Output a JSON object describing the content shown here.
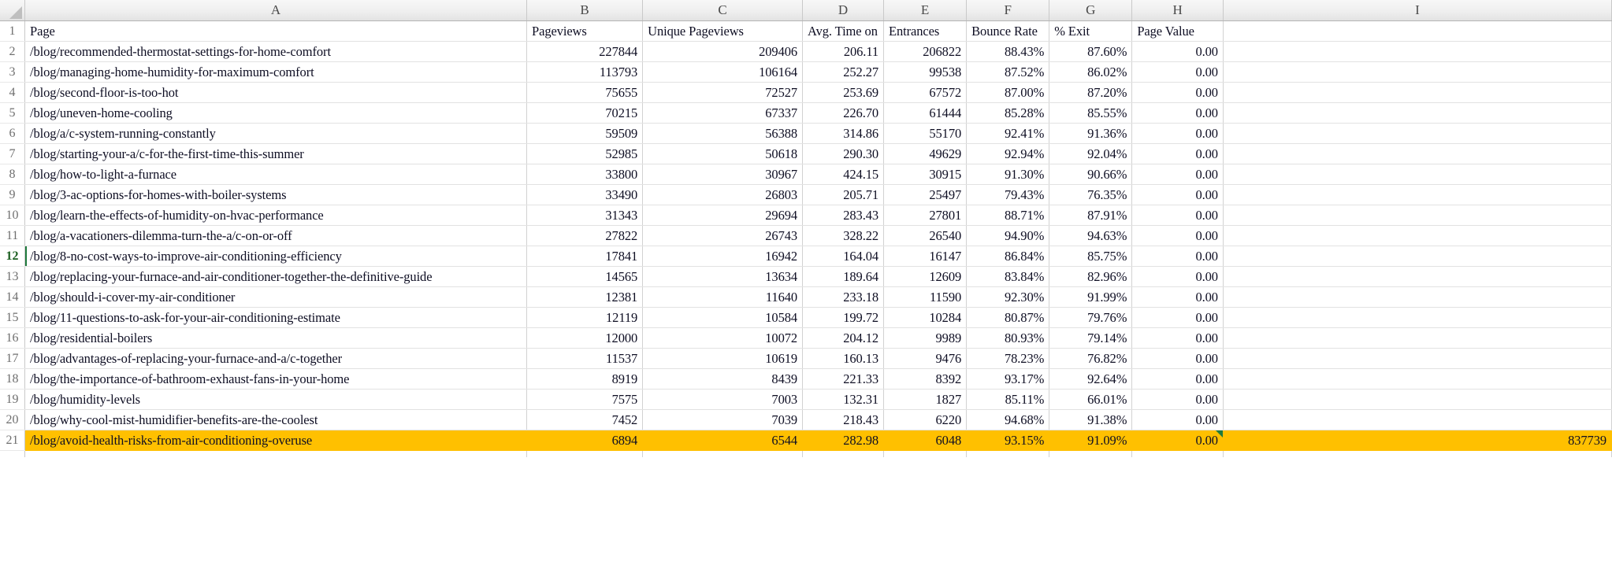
{
  "app": {
    "type": "spreadsheet",
    "highlight_color": "#ffc000",
    "active_color": "#1f7a3d"
  },
  "column_letters": [
    "A",
    "B",
    "C",
    "D",
    "E",
    "F",
    "G",
    "H",
    "I"
  ],
  "headers": [
    "Page",
    "Pageviews",
    "Unique Pageviews",
    "Avg. Time on",
    "Entrances",
    "Bounce Rate",
    "% Exit",
    "Page Value",
    ""
  ],
  "rows": [
    {
      "n": "2",
      "page": "/blog/recommended-thermostat-settings-for-home-comfort",
      "pageviews": "227844",
      "unique": "209406",
      "time": "206.11",
      "entrances": "206822",
      "bounce": "88.43%",
      "exit": "87.60%",
      "value": "0.00",
      "extra": ""
    },
    {
      "n": "3",
      "page": "/blog/managing-home-humidity-for-maximum-comfort",
      "pageviews": "113793",
      "unique": "106164",
      "time": "252.27",
      "entrances": "99538",
      "bounce": "87.52%",
      "exit": "86.02%",
      "value": "0.00",
      "extra": ""
    },
    {
      "n": "4",
      "page": "/blog/second-floor-is-too-hot",
      "pageviews": "75655",
      "unique": "72527",
      "time": "253.69",
      "entrances": "67572",
      "bounce": "87.00%",
      "exit": "87.20%",
      "value": "0.00",
      "extra": ""
    },
    {
      "n": "5",
      "page": "/blog/uneven-home-cooling",
      "pageviews": "70215",
      "unique": "67337",
      "time": "226.70",
      "entrances": "61444",
      "bounce": "85.28%",
      "exit": "85.55%",
      "value": "0.00",
      "extra": ""
    },
    {
      "n": "6",
      "page": "/blog/a/c-system-running-constantly",
      "pageviews": "59509",
      "unique": "56388",
      "time": "314.86",
      "entrances": "55170",
      "bounce": "92.41%",
      "exit": "91.36%",
      "value": "0.00",
      "extra": ""
    },
    {
      "n": "7",
      "page": "/blog/starting-your-a/c-for-the-first-time-this-summer",
      "pageviews": "52985",
      "unique": "50618",
      "time": "290.30",
      "entrances": "49629",
      "bounce": "92.94%",
      "exit": "92.04%",
      "value": "0.00",
      "extra": ""
    },
    {
      "n": "8",
      "page": "/blog/how-to-light-a-furnace",
      "pageviews": "33800",
      "unique": "30967",
      "time": "424.15",
      "entrances": "30915",
      "bounce": "91.30%",
      "exit": "90.66%",
      "value": "0.00",
      "extra": ""
    },
    {
      "n": "9",
      "page": "/blog/3-ac-options-for-homes-with-boiler-systems",
      "pageviews": "33490",
      "unique": "26803",
      "time": "205.71",
      "entrances": "25497",
      "bounce": "79.43%",
      "exit": "76.35%",
      "value": "0.00",
      "extra": ""
    },
    {
      "n": "10",
      "page": "/blog/learn-the-effects-of-humidity-on-hvac-performance",
      "pageviews": "31343",
      "unique": "29694",
      "time": "283.43",
      "entrances": "27801",
      "bounce": "88.71%",
      "exit": "87.91%",
      "value": "0.00",
      "extra": ""
    },
    {
      "n": "11",
      "page": "/blog/a-vacationers-dilemma-turn-the-a/c-on-or-off",
      "pageviews": "27822",
      "unique": "26743",
      "time": "328.22",
      "entrances": "26540",
      "bounce": "94.90%",
      "exit": "94.63%",
      "value": "0.00",
      "extra": ""
    },
    {
      "n": "12",
      "page": "/blog/8-no-cost-ways-to-improve-air-conditioning-efficiency",
      "pageviews": "17841",
      "unique": "16942",
      "time": "164.04",
      "entrances": "16147",
      "bounce": "86.84%",
      "exit": "85.75%",
      "value": "0.00",
      "extra": ""
    },
    {
      "n": "13",
      "page": "/blog/replacing-your-furnace-and-air-conditioner-together-the-definitive-guide",
      "pageviews": "14565",
      "unique": "13634",
      "time": "189.64",
      "entrances": "12609",
      "bounce": "83.84%",
      "exit": "82.96%",
      "value": "0.00",
      "extra": ""
    },
    {
      "n": "14",
      "page": "/blog/should-i-cover-my-air-conditioner",
      "pageviews": "12381",
      "unique": "11640",
      "time": "233.18",
      "entrances": "11590",
      "bounce": "92.30%",
      "exit": "91.99%",
      "value": "0.00",
      "extra": ""
    },
    {
      "n": "15",
      "page": "/blog/11-questions-to-ask-for-your-air-conditioning-estimate",
      "pageviews": "12119",
      "unique": "10584",
      "time": "199.72",
      "entrances": "10284",
      "bounce": "80.87%",
      "exit": "79.76%",
      "value": "0.00",
      "extra": ""
    },
    {
      "n": "16",
      "page": "/blog/residential-boilers",
      "pageviews": "12000",
      "unique": "10072",
      "time": "204.12",
      "entrances": "9989",
      "bounce": "80.93%",
      "exit": "79.14%",
      "value": "0.00",
      "extra": ""
    },
    {
      "n": "17",
      "page": "/blog/advantages-of-replacing-your-furnace-and-a/c-together",
      "pageviews": "11537",
      "unique": "10619",
      "time": "160.13",
      "entrances": "9476",
      "bounce": "78.23%",
      "exit": "76.82%",
      "value": "0.00",
      "extra": ""
    },
    {
      "n": "18",
      "page": "/blog/the-importance-of-bathroom-exhaust-fans-in-your-home",
      "pageviews": "8919",
      "unique": "8439",
      "time": "221.33",
      "entrances": "8392",
      "bounce": "93.17%",
      "exit": "92.64%",
      "value": "0.00",
      "extra": ""
    },
    {
      "n": "19",
      "page": "/blog/humidity-levels",
      "pageviews": "7575",
      "unique": "7003",
      "time": "132.31",
      "entrances": "1827",
      "bounce": "85.11%",
      "exit": "66.01%",
      "value": "0.00",
      "extra": ""
    },
    {
      "n": "20",
      "page": "/blog/why-cool-mist-humidifier-benefits-are-the-coolest",
      "pageviews": "7452",
      "unique": "7039",
      "time": "218.43",
      "entrances": "6220",
      "bounce": "94.68%",
      "exit": "91.38%",
      "value": "0.00",
      "extra": ""
    },
    {
      "n": "21",
      "page": "/blog/avoid-health-risks-from-air-conditioning-overuse",
      "pageviews": "6894",
      "unique": "6544",
      "time": "282.98",
      "entrances": "6048",
      "bounce": "93.15%",
      "exit": "91.09%",
      "value": "0.00",
      "extra": "837739"
    }
  ],
  "active_row_index": 10,
  "highlight_row_index": 19
}
